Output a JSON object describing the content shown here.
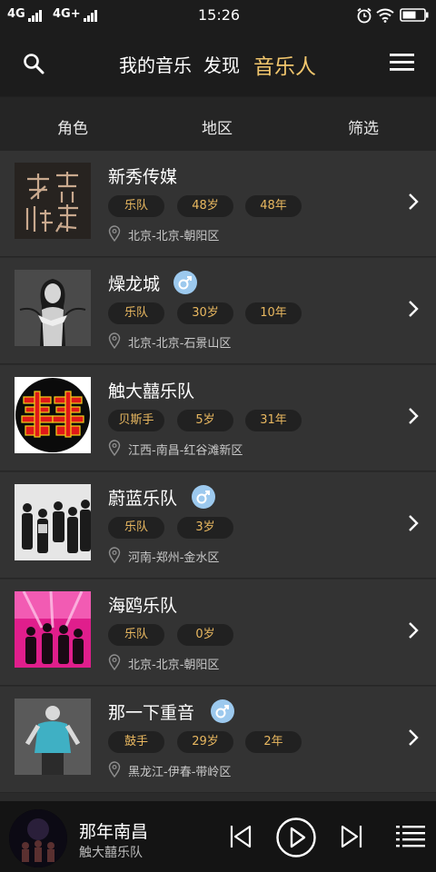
{
  "status_bar": {
    "signal_1": "4G",
    "signal_2": "4G+",
    "time": "15:26",
    "icons": [
      "alarm-icon",
      "wifi-icon",
      "battery-icon"
    ]
  },
  "header": {
    "tabs": [
      {
        "label": "我的音乐",
        "active": false
      },
      {
        "label": "发现",
        "active": false
      },
      {
        "label": "音乐人",
        "active": true
      }
    ],
    "icons": [
      "search-icon",
      "menu-icon"
    ]
  },
  "filters": [
    {
      "label": "角色"
    },
    {
      "label": "地区"
    },
    {
      "label": "筛选"
    }
  ],
  "artists": [
    {
      "name": "新秀传媒",
      "gender_icon": "",
      "tags": [
        "乐队",
        "48岁",
        "48年"
      ],
      "location": "北京-北京-朝阳区",
      "thumb": "calligraphy-logo"
    },
    {
      "name": "燥龙城",
      "gender_icon": "male-icon",
      "tags": [
        "乐队",
        "30岁",
        "10年"
      ],
      "location": "北京-北京-石景山区",
      "thumb": "bw-portrait"
    },
    {
      "name": "触大囍乐队",
      "gender_icon": "",
      "tags": [
        "贝斯手",
        "5岁",
        "31年"
      ],
      "location": "江西-南昌-红谷滩新区",
      "thumb": "red-logo"
    },
    {
      "name": "蔚蓝乐队",
      "gender_icon": "male-icon",
      "tags": [
        "乐队",
        "3岁"
      ],
      "location": "河南-郑州-金水区",
      "thumb": "band-photo"
    },
    {
      "name": "海鸥乐队",
      "gender_icon": "",
      "tags": [
        "乐队",
        "0岁"
      ],
      "location": "北京-北京-朝阳区",
      "thumb": "pink-stage"
    },
    {
      "name": "那一下重音",
      "gender_icon": "male-icon",
      "tags": [
        "鼓手",
        "29岁",
        "2年"
      ],
      "location": "黑龙江-伊春-带岭区",
      "thumb": "sketch-figure"
    }
  ],
  "player": {
    "song": "那年南昌",
    "artist": "触大囍乐队",
    "controls": [
      "previous-icon",
      "play-icon",
      "next-icon",
      "playlist-icon"
    ]
  },
  "colors": {
    "accent": "#f1c66d",
    "tag_text": "#e9b860",
    "row_bg": "#333333",
    "header_bg": "#1c1c1c",
    "male_badge": "#9cc9ee"
  }
}
